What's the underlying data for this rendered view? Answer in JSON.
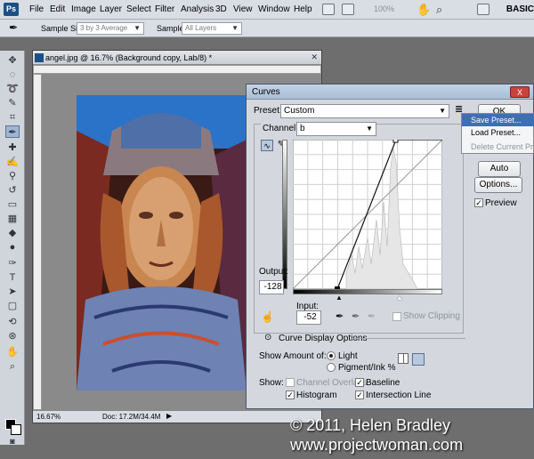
{
  "menubar": {
    "app_logo": "Ps",
    "items": [
      "File",
      "Edit",
      "Image",
      "Layer",
      "Select",
      "Filter",
      "Analysis",
      "3D",
      "View",
      "Window",
      "Help"
    ],
    "zoom": "100%",
    "workspace": "BASIC"
  },
  "options_bar": {
    "sample_size_label": "Sample Size:",
    "sample_size_value": "3 by 3 Average",
    "sample_label": "Sample:",
    "sample_value": "All Layers"
  },
  "document": {
    "title": "angel.jpg @ 16.7% (Background copy, Lab/8) *",
    "zoom_status": "16.67%",
    "doc_status": "Doc: 17.2M/34.4M"
  },
  "curves": {
    "title": "Curves",
    "close_label": "X",
    "preset_label": "Preset:",
    "preset_value": "Custom",
    "channel_label": "Channel:",
    "channel_value": "b",
    "output_label": "Output:",
    "output_value": "-128",
    "input_label": "Input:",
    "input_value": "-52",
    "show_clipping_label": "Show Clipping",
    "display_options_label": "Curve Display Options",
    "show_amount_label": "Show Amount of:",
    "light_label": "Light",
    "pigment_label": "Pigment/Ink %",
    "show_label": "Show:",
    "channel_overlays_label": "Channel Overlays",
    "baseline_label": "Baseline",
    "histogram_label": "Histogram",
    "intersection_label": "Intersection Line",
    "ok_label": "OK",
    "auto_label": "Auto",
    "options_label": "Options...",
    "preview_label": "Preview"
  },
  "preset_menu": {
    "items": [
      "Save Preset...",
      "Load Preset...",
      "Delete Current Prese"
    ]
  },
  "watermark": {
    "line1": "© 2011, Helen Bradley",
    "line2": "www.projectwoman.com"
  }
}
